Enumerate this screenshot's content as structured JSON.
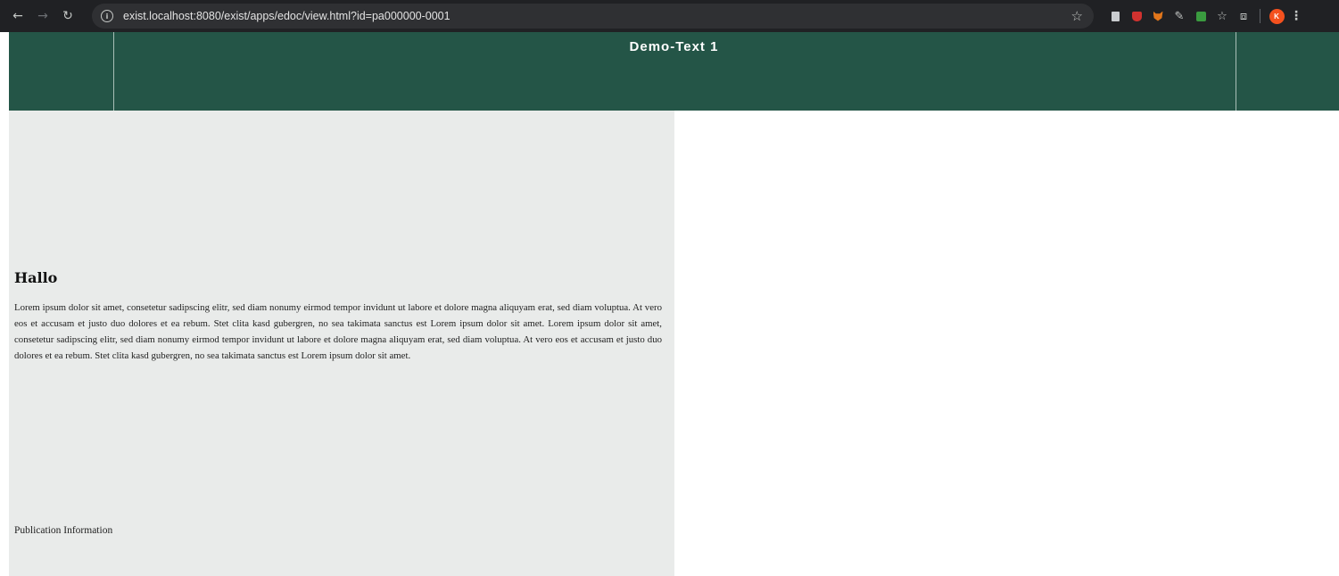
{
  "browser": {
    "url": "exist.localhost:8080/exist/apps/edoc/view.html?id=pa000000-0001",
    "avatar_initial": "K"
  },
  "header": {
    "title": "Demo-Text 1",
    "background_color": "#245547"
  },
  "content": {
    "heading": "Hallo",
    "paragraph": "Lorem ipsum dolor sit amet, consetetur sadipscing elitr, sed diam nonumy eirmod tempor invidunt ut labore et dolore magna aliquyam erat, sed diam voluptua. At vero eos et accusam et justo duo dolores et ea rebum. Stet clita kasd gubergren, no sea takimata sanctus est Lorem ipsum dolor sit amet. Lorem ipsum dolor sit amet, consetetur sadipscing elitr, sed diam nonumy eirmod tempor invidunt ut labore et dolore magna aliquyam erat, sed diam voluptua. At vero eos et accusam et justo duo dolores et ea rebum. Stet clita kasd gubergren, no sea takimata sanctus est Lorem ipsum dolor sit amet.",
    "publication_info": "Publication Information",
    "panel_color": "#e9ebea"
  }
}
